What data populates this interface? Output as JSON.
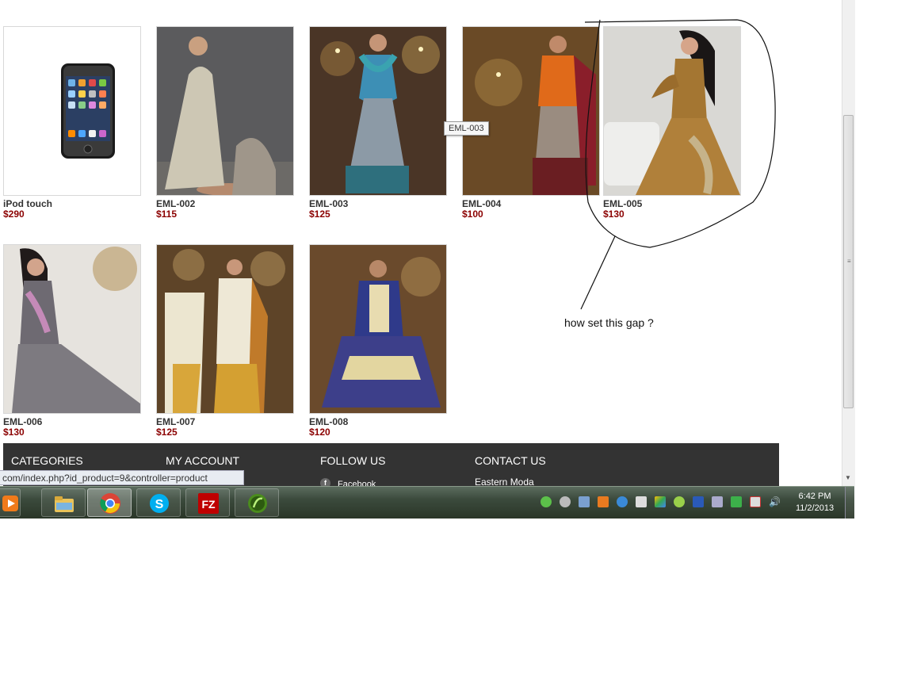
{
  "products": [
    {
      "name": "iPod touch",
      "price": "$290"
    },
    {
      "name": "EML-002",
      "price": "$115"
    },
    {
      "name": "EML-003",
      "price": "$125"
    },
    {
      "name": "EML-004",
      "price": "$100"
    },
    {
      "name": "EML-005",
      "price": "$130"
    },
    {
      "name": "EML-006",
      "price": "$130"
    },
    {
      "name": "EML-007",
      "price": "$125"
    },
    {
      "name": "EML-008",
      "price": "$120"
    }
  ],
  "tooltip": "EML-003",
  "annotation": "how set this gap ?",
  "footer": {
    "categories": "CATEGORIES",
    "my_account": "MY ACCOUNT",
    "follow_us": "FOLLOW US",
    "contact_us": "CONTACT US",
    "facebook": "Facebook",
    "contact_name": "Eastern Moda"
  },
  "status_url": "com/index.php?id_product=9&controller=product",
  "clock": {
    "time": "6:42 PM",
    "date": "11/2/2013"
  },
  "taskbar_apps": [
    "media-player-icon",
    "file-explorer-icon",
    "chrome-icon",
    "skype-icon",
    "filezilla-icon",
    "dreamweaver-icon"
  ],
  "colors": {
    "price": "#8b0000",
    "footer_bg": "#333333"
  }
}
